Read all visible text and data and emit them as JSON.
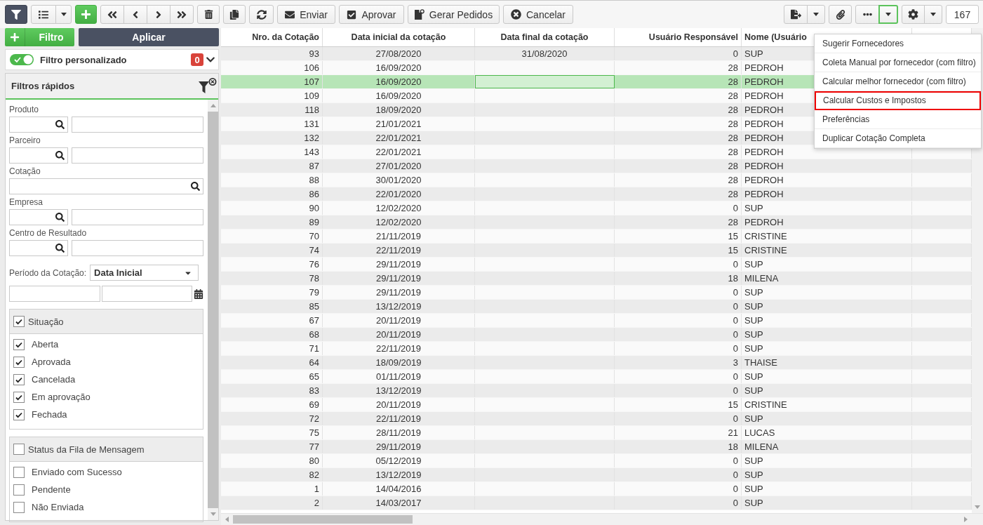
{
  "toolbar": {
    "filter_toggle": {
      "on": true
    },
    "actions": [
      {
        "label": "Enviar"
      },
      {
        "label": "Aprovar"
      },
      {
        "label": "Gerar Pedidos"
      },
      {
        "label": "Cancelar"
      }
    ],
    "more_menu": {
      "open": true
    },
    "record_count": "167"
  },
  "filter_panel": {
    "add_button": "Filtro",
    "apply_button": "Aplicar",
    "custom_filter": {
      "label": "Filtro personalizado",
      "on": true,
      "count": "0"
    },
    "quick_filters": {
      "title": "Filtros rápidos",
      "fields": [
        {
          "kind": "lookup",
          "label": "Produto"
        },
        {
          "kind": "lookup",
          "label": "Parceiro"
        },
        {
          "kind": "search",
          "label": "Cotação"
        },
        {
          "kind": "lookup",
          "label": "Empresa"
        },
        {
          "kind": "lookup",
          "label": "Centro de Resultado"
        }
      ],
      "period": {
        "label": "Período da Cotação:",
        "value": "Data Inicial"
      },
      "groups": [
        {
          "title": "Situação",
          "checked": true,
          "options": [
            {
              "label": "Aberta",
              "checked": true
            },
            {
              "label": "Aprovada",
              "checked": true
            },
            {
              "label": "Cancelada",
              "checked": true
            },
            {
              "label": "Em aprovação",
              "checked": true
            },
            {
              "label": "Fechada",
              "checked": true
            }
          ]
        },
        {
          "title": "Status da Fila de Mensagem",
          "checked": false,
          "options": [
            {
              "label": "Enviado com Sucesso",
              "checked": false
            },
            {
              "label": "Pendente",
              "checked": false
            },
            {
              "label": "Não Enviada",
              "checked": false
            }
          ]
        }
      ]
    }
  },
  "table": {
    "columns": [
      "Nro. da Cotação",
      "Data inicial da cotação",
      "Data final da cotação",
      "Usuário Responsável",
      "Nome (Usuário"
    ],
    "rows": [
      {
        "nro": "93",
        "data_inicial": "27/08/2020",
        "data_final": "31/08/2020",
        "usuario": "0",
        "nome": "SUP",
        "selected": false
      },
      {
        "nro": "106",
        "data_inicial": "16/09/2020",
        "usuario": "28",
        "nome": "PEDROH",
        "selected": false
      },
      {
        "nro": "107",
        "data_inicial": "16/09/2020",
        "usuario": "28",
        "nome": "PEDROH",
        "selected": true
      },
      {
        "nro": "109",
        "data_inicial": "16/09/2020",
        "usuario": "28",
        "nome": "PEDROH",
        "selected": false
      },
      {
        "nro": "118",
        "data_inicial": "18/09/2020",
        "usuario": "28",
        "nome": "PEDROH",
        "selected": false
      },
      {
        "nro": "131",
        "data_inicial": "21/01/2021",
        "usuario": "28",
        "nome": "PEDROH",
        "selected": false
      },
      {
        "nro": "132",
        "data_inicial": "22/01/2021",
        "usuario": "28",
        "nome": "PEDROH",
        "selected": false
      },
      {
        "nro": "143",
        "data_inicial": "22/01/2021",
        "usuario": "28",
        "nome": "PEDROH",
        "selected": false
      },
      {
        "nro": "87",
        "data_inicial": "27/01/2020",
        "usuario": "28",
        "nome": "PEDROH",
        "selected": false
      },
      {
        "nro": "88",
        "data_inicial": "30/01/2020",
        "usuario": "28",
        "nome": "PEDROH",
        "selected": false
      },
      {
        "nro": "86",
        "data_inicial": "22/01/2020",
        "usuario": "28",
        "nome": "PEDROH",
        "selected": false
      },
      {
        "nro": "90",
        "data_inicial": "12/02/2020",
        "usuario": "0",
        "nome": "SUP",
        "selected": false
      },
      {
        "nro": "89",
        "data_inicial": "12/02/2020",
        "usuario": "28",
        "nome": "PEDROH",
        "selected": false
      },
      {
        "nro": "70",
        "data_inicial": "21/11/2019",
        "usuario": "15",
        "nome": "CRISTINE",
        "selected": false
      },
      {
        "nro": "74",
        "data_inicial": "22/11/2019",
        "usuario": "15",
        "nome": "CRISTINE",
        "selected": false
      },
      {
        "nro": "76",
        "data_inicial": "29/11/2019",
        "usuario": "0",
        "nome": "SUP",
        "selected": false
      },
      {
        "nro": "78",
        "data_inicial": "29/11/2019",
        "usuario": "18",
        "nome": "MILENA",
        "selected": false
      },
      {
        "nro": "79",
        "data_inicial": "29/11/2019",
        "usuario": "0",
        "nome": "SUP",
        "selected": false
      },
      {
        "nro": "85",
        "data_inicial": "13/12/2019",
        "usuario": "0",
        "nome": "SUP",
        "selected": false
      },
      {
        "nro": "67",
        "data_inicial": "20/11/2019",
        "usuario": "0",
        "nome": "SUP",
        "selected": false
      },
      {
        "nro": "68",
        "data_inicial": "20/11/2019",
        "usuario": "0",
        "nome": "SUP",
        "selected": false
      },
      {
        "nro": "71",
        "data_inicial": "22/11/2019",
        "usuario": "0",
        "nome": "SUP",
        "selected": false
      },
      {
        "nro": "64",
        "data_inicial": "18/09/2019",
        "usuario": "3",
        "nome": "THAISE",
        "selected": false
      },
      {
        "nro": "65",
        "data_inicial": "01/11/2019",
        "usuario": "0",
        "nome": "SUP",
        "selected": false
      },
      {
        "nro": "83",
        "data_inicial": "13/12/2019",
        "usuario": "0",
        "nome": "SUP",
        "selected": false
      },
      {
        "nro": "69",
        "data_inicial": "20/11/2019",
        "usuario": "15",
        "nome": "CRISTINE",
        "selected": false
      },
      {
        "nro": "72",
        "data_inicial": "22/11/2019",
        "usuario": "0",
        "nome": "SUP",
        "selected": false
      },
      {
        "nro": "75",
        "data_inicial": "28/11/2019",
        "usuario": "21",
        "nome": "LUCAS",
        "selected": false
      },
      {
        "nro": "77",
        "data_inicial": "29/11/2019",
        "usuario": "18",
        "nome": "MILENA",
        "selected": false
      },
      {
        "nro": "80",
        "data_inicial": "05/12/2019",
        "usuario": "0",
        "nome": "SUP",
        "selected": false
      },
      {
        "nro": "82",
        "data_inicial": "13/12/2019",
        "usuario": "0",
        "nome": "SUP",
        "selected": false
      },
      {
        "nro": "1",
        "data_inicial": "14/04/2016",
        "usuario": "0",
        "nome": "SUP",
        "selected": false
      },
      {
        "nro": "2",
        "data_inicial": "14/03/2017",
        "usuario": "0",
        "nome": "SUP",
        "selected": false
      }
    ]
  },
  "menu": {
    "items": [
      {
        "label": "Sugerir Fornecedores",
        "highlighted": false
      },
      {
        "label": "Coleta Manual por fornecedor (com filtro)",
        "highlighted": false
      },
      {
        "label": "Calcular melhor fornecedor (com filtro)",
        "highlighted": false
      },
      {
        "label": "Calcular Custos e Impostos",
        "highlighted": true
      },
      {
        "label": "Preferências",
        "highlighted": false
      },
      {
        "label": "Duplicar Cotação Completa",
        "highlighted": false
      }
    ]
  }
}
